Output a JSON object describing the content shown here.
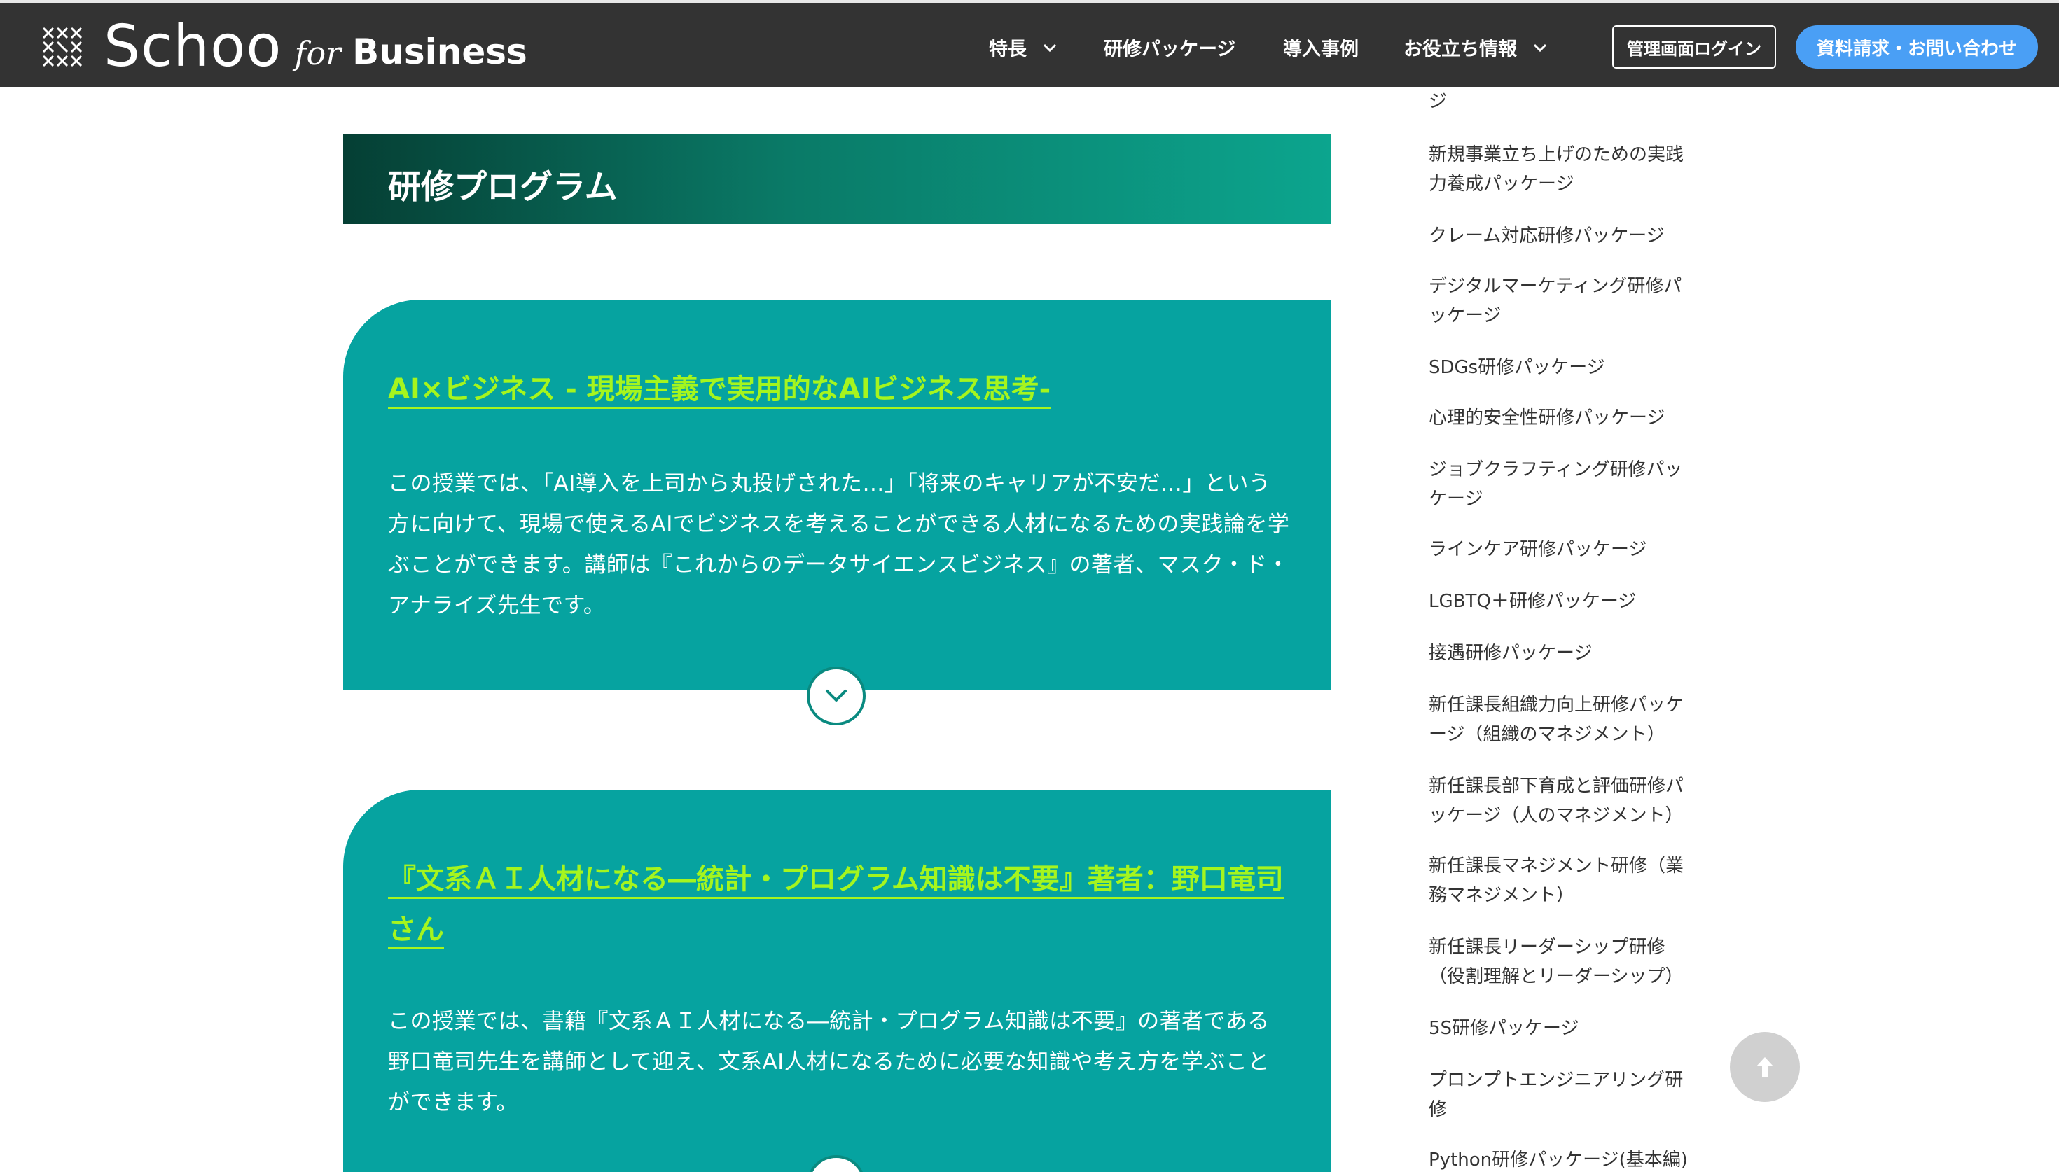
{
  "header": {
    "logo": {
      "main": "Schoo",
      "for": "for",
      "business": "Business"
    },
    "nav": [
      {
        "label": "特長",
        "dropdown": true
      },
      {
        "label": "研修パッケージ",
        "dropdown": false
      },
      {
        "label": "導入事例",
        "dropdown": false
      },
      {
        "label": "お役立ち情報",
        "dropdown": true
      }
    ],
    "login_label": "管理画面ログイン",
    "contact_label": "資料請求・お問い合わせ"
  },
  "main": {
    "section_title": "研修プログラム",
    "cards": [
      {
        "title": "AI×ビジネス - 現場主義で実用的なAIビジネス思考-",
        "description": "この授業では、「AI導入を上司から丸投げされた…」「将来のキャリアが不安だ…」という方に向けて、現場で使えるAIでビジネスを考えることができる人材になるための実践論を学ぶことができます。講師は『これからのデータサイエンスビジネス』の著者、マスク・ド・アナライズ先生です。"
      },
      {
        "title": "『文系ＡＩ人材になる―統計・プログラム知識は不要』著者：野口竜司さん",
        "description": "この授業では、書籍『文系ＡＩ人材になる―統計・プログラム知識は不要』の著者である野口竜司先生を講師として迎え、文系AI人材になるために必要な知識や考え方を学ぶことができます。"
      }
    ]
  },
  "sidebar": {
    "items": [
      "ジ",
      "新規事業立ち上げのための実践力養成パッケージ",
      "クレーム対応研修パッケージ",
      "デジタルマーケティング研修パッケージ",
      "SDGs研修パッケージ",
      "心理的安全性研修パッケージ",
      "ジョブクラフティング研修パッケージ",
      "ラインケア研修パッケージ",
      "LGBTQ＋研修パッケージ",
      "接遇研修パッケージ",
      "新任課長組織力向上研修パッケージ（組織のマネジメント）",
      "新任課長部下育成と評価研修パッケージ（人のマネジメント）",
      "新任課長マネジメント研修（業務マネジメント）",
      "新任課長リーダーシップ研修（役割理解とリーダーシップ）",
      "5S研修パッケージ",
      "プロンプトエンジニアリング研修",
      "Python研修パッケージ(基本編)"
    ]
  },
  "icons": {
    "logo_mark": "schoo-logo-mark-icon",
    "nav_dropdown": "chevron-down-icon",
    "expand": "chevron-down-circle-icon",
    "scroll_top": "arrow-up-icon"
  },
  "colors": {
    "header_bg": "#333333",
    "card_bg": "#06a3a0",
    "card_title": "#a5f51e",
    "contact_button": "#4a9ff5"
  }
}
